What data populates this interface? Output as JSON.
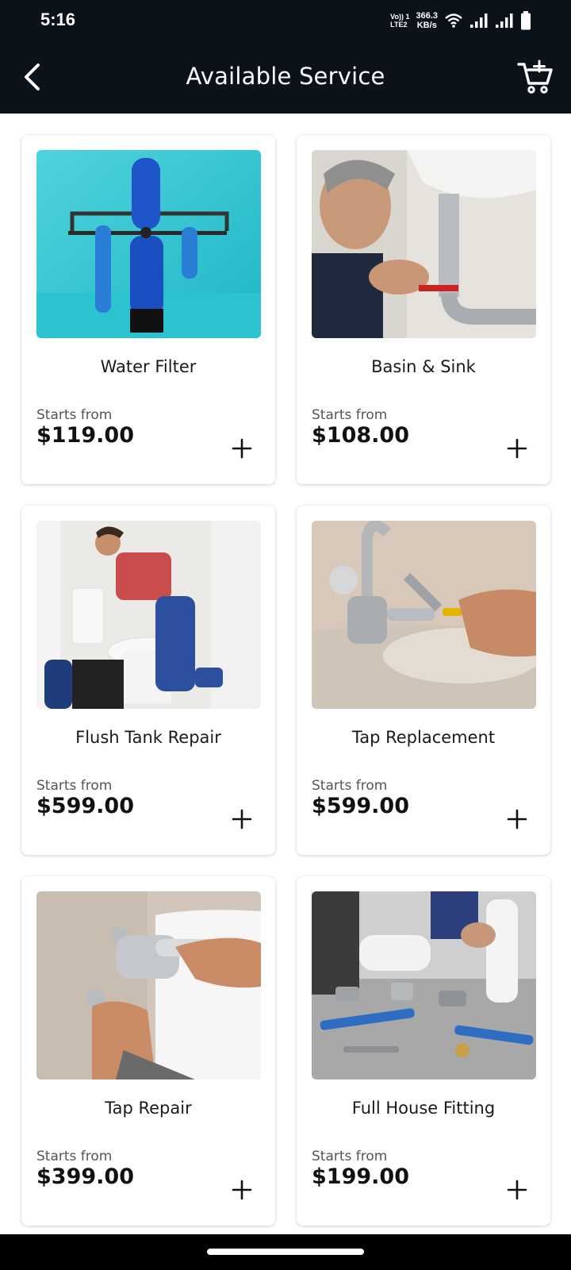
{
  "status_bar": {
    "time": "5:16",
    "volte_top": "Vo)) 1",
    "volte_bottom": "LTE2",
    "speed_value": "366.3",
    "speed_unit": "KB/s"
  },
  "header": {
    "title": "Available Service",
    "back_icon": "chevron-left-icon",
    "cart_icon": "cart-add-icon"
  },
  "common": {
    "starts_from_label": "Starts from"
  },
  "services": [
    {
      "name": "Water Filter",
      "starts_from": "Starts from",
      "price": "$119.00"
    },
    {
      "name": "Basin & Sink",
      "starts_from": "Starts from",
      "price": "$108.00"
    },
    {
      "name": "Flush Tank Repair",
      "starts_from": "Starts from",
      "price": "$599.00"
    },
    {
      "name": "Tap Replacement",
      "starts_from": "Starts from",
      "price": "$599.00"
    },
    {
      "name": "Tap Repair",
      "starts_from": "Starts from",
      "price": "$399.00"
    },
    {
      "name": "Full House Fitting",
      "starts_from": "Starts from",
      "price": "$199.00"
    }
  ],
  "colors": {
    "header_bg": "#0a121a",
    "card_bg": "#ffffff",
    "text_primary": "#111111"
  }
}
